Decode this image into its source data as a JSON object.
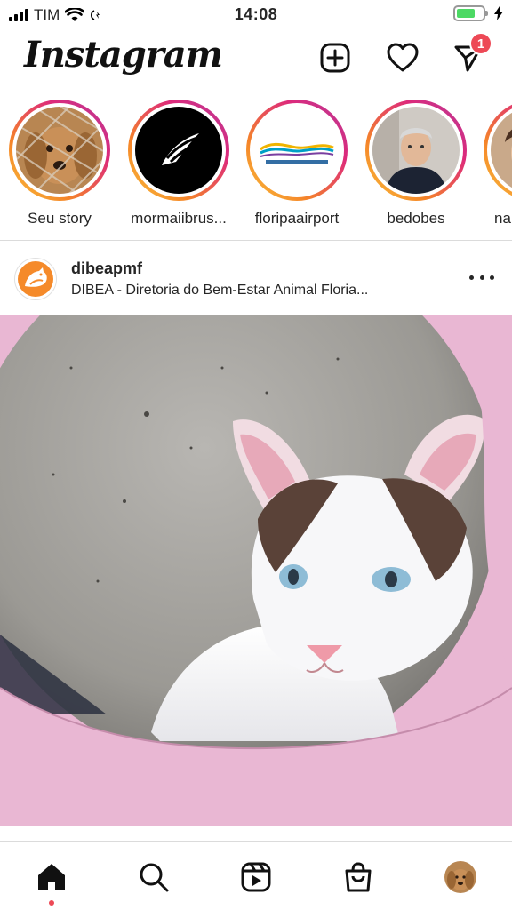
{
  "status_bar": {
    "carrier": "TIM",
    "time": "14:08"
  },
  "header": {
    "logo": "Instagram",
    "new_post_icon": "plus-square-icon",
    "activity_icon": "heart-icon",
    "messages_icon": "direct-send-icon",
    "messages_badge": "1"
  },
  "stories": [
    {
      "label": "Seu story",
      "picture": "dog behind fence"
    },
    {
      "label": "mormaiibrus...",
      "picture": "mormaii logo"
    },
    {
      "label": "floripaairport",
      "picture": "floripa airport logo"
    },
    {
      "label": "bedobes",
      "picture": "man portrait"
    },
    {
      "label": "na",
      "picture": "woman portrait"
    }
  ],
  "post": {
    "username": "dibeapmf",
    "subtitle": "DIBEA - Diretoria do Bem-Estar Animal Floria...",
    "more_icon": "more-horizontal-icon",
    "image": "white and brown kitten with blue eyes inside pink tube"
  },
  "colors": {
    "accent": "#ed4956",
    "story_ring_start": "#f9c33c",
    "story_ring_end": "#b53a99",
    "battery": "#4cd964"
  },
  "bottom_nav": {
    "home_icon": "home-icon",
    "search_icon": "search-icon",
    "reels_icon": "reels-icon",
    "shop_icon": "shopping-bag-icon",
    "profile_icon": "profile-avatar"
  }
}
